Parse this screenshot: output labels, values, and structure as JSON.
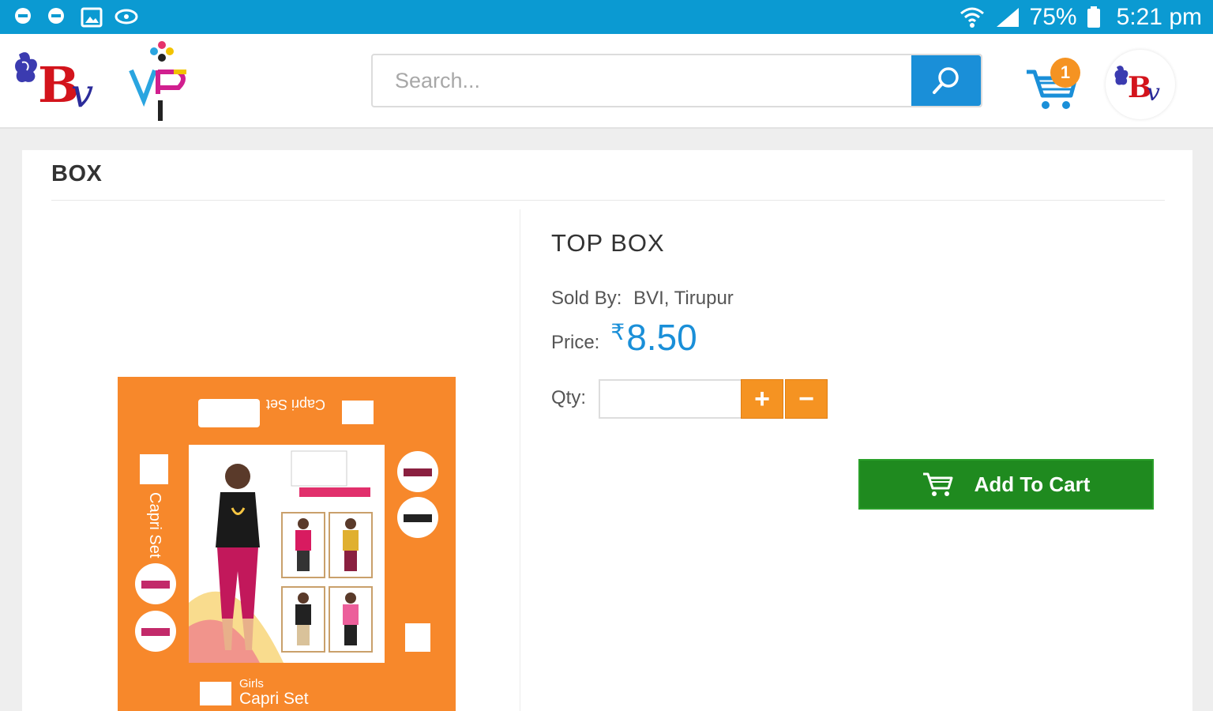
{
  "status_bar": {
    "battery": "75%",
    "time": "5:21 pm"
  },
  "header": {
    "search": {
      "placeholder": "Search..."
    },
    "cart_count": "1"
  },
  "category": {
    "title": "BOX"
  },
  "product": {
    "title": "TOP BOX",
    "sold_by_label": "Sold By:",
    "sold_by_value": "BVI, Tirupur",
    "price_label": "Price:",
    "currency": "₹",
    "price": "8.50",
    "qty_label": "Qty:",
    "qty_value": "",
    "plus_label": "+",
    "minus_label": "−",
    "add_to_cart_label": "Add To Cart",
    "image": {
      "box_title": "Capri Set",
      "box_subtitle": "Girls",
      "banner_text": "Girls Capri Set"
    }
  },
  "colors": {
    "status_bar": "#0b9ad2",
    "accent_blue": "#1a8fd8",
    "orange": "#f59322",
    "green": "#1f8a1f"
  }
}
